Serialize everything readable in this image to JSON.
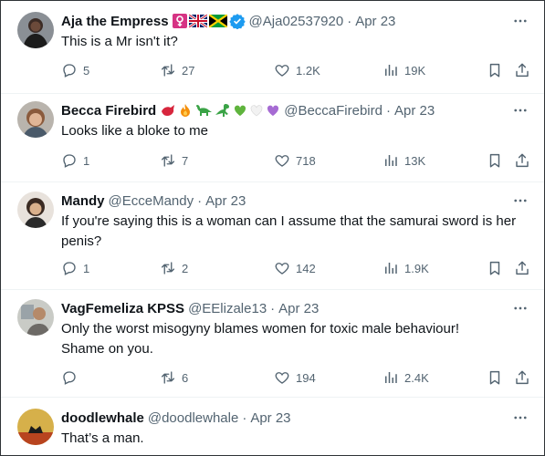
{
  "replies": [
    {
      "name": "Aja the Empress",
      "handle": "@Aja02537920",
      "date": "Apr 23",
      "text": "This is a Mr isn't it?",
      "verified": true,
      "stats": {
        "replies": "5",
        "retweets": "27",
        "likes": "1.2K",
        "views": "19K"
      }
    },
    {
      "name": "Becca Firebird",
      "handle": "@BeccaFirebird",
      "date": "Apr 23",
      "text": "Looks like a bloke to me",
      "stats": {
        "replies": "1",
        "retweets": "7",
        "likes": "718",
        "views": "13K"
      }
    },
    {
      "name": "Mandy",
      "handle": "@EcceMandy",
      "date": "Apr 23",
      "text": "If you're saying this is a woman can I assume that the samurai sword is her penis?",
      "stats": {
        "replies": "1",
        "retweets": "2",
        "likes": "142",
        "views": "1.9K"
      }
    },
    {
      "name": "VagFemeliza KPSS",
      "handle": "@EElizale13",
      "date": "Apr 23",
      "text": "Only the worst misogyny blames women for toxic male behaviour! Shame on you.",
      "stats": {
        "replies": "",
        "retweets": "6",
        "likes": "194",
        "views": "2.4K"
      }
    },
    {
      "name": "doodlewhale",
      "handle": "@doodlewhale",
      "date": "Apr 23",
      "text": "That’s a man."
    }
  ],
  "separator": "·",
  "more_label": "···",
  "icons": [
    "more-icon",
    "reply-icon",
    "retweet-icon",
    "like-icon",
    "views-icon",
    "bookmark-icon",
    "share-icon",
    "verified-icon"
  ],
  "colors": {
    "text": "#0f1419",
    "muted": "#536471",
    "verified": "#1d9bf0",
    "divider": "#eff3f4"
  }
}
